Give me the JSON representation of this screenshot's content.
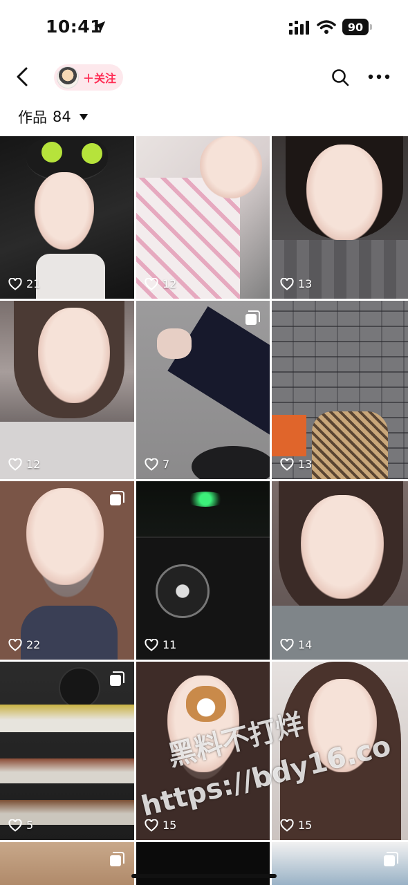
{
  "status_bar": {
    "time": "10:41",
    "battery": "90"
  },
  "nav": {
    "follow_label": "＋关注"
  },
  "works": {
    "label": "作品",
    "count": "84"
  },
  "grid": [
    {
      "likes": "21",
      "multi": false
    },
    {
      "likes": "12",
      "multi": false
    },
    {
      "likes": "13",
      "multi": false
    },
    {
      "likes": "12",
      "multi": false
    },
    {
      "likes": "7",
      "multi": true
    },
    {
      "likes": "13",
      "multi": false
    },
    {
      "likes": "22",
      "multi": true
    },
    {
      "likes": "11",
      "multi": false
    },
    {
      "likes": "14",
      "multi": false
    },
    {
      "likes": "5",
      "multi": true
    },
    {
      "likes": "15",
      "multi": false
    },
    {
      "likes": "15",
      "multi": false
    }
  ],
  "watermark": {
    "line1": "黑料不打烊",
    "line2": "https://bdy16.co"
  },
  "colors": {
    "accent": "#ff2d55",
    "follow_bg": "#fde8ec"
  }
}
